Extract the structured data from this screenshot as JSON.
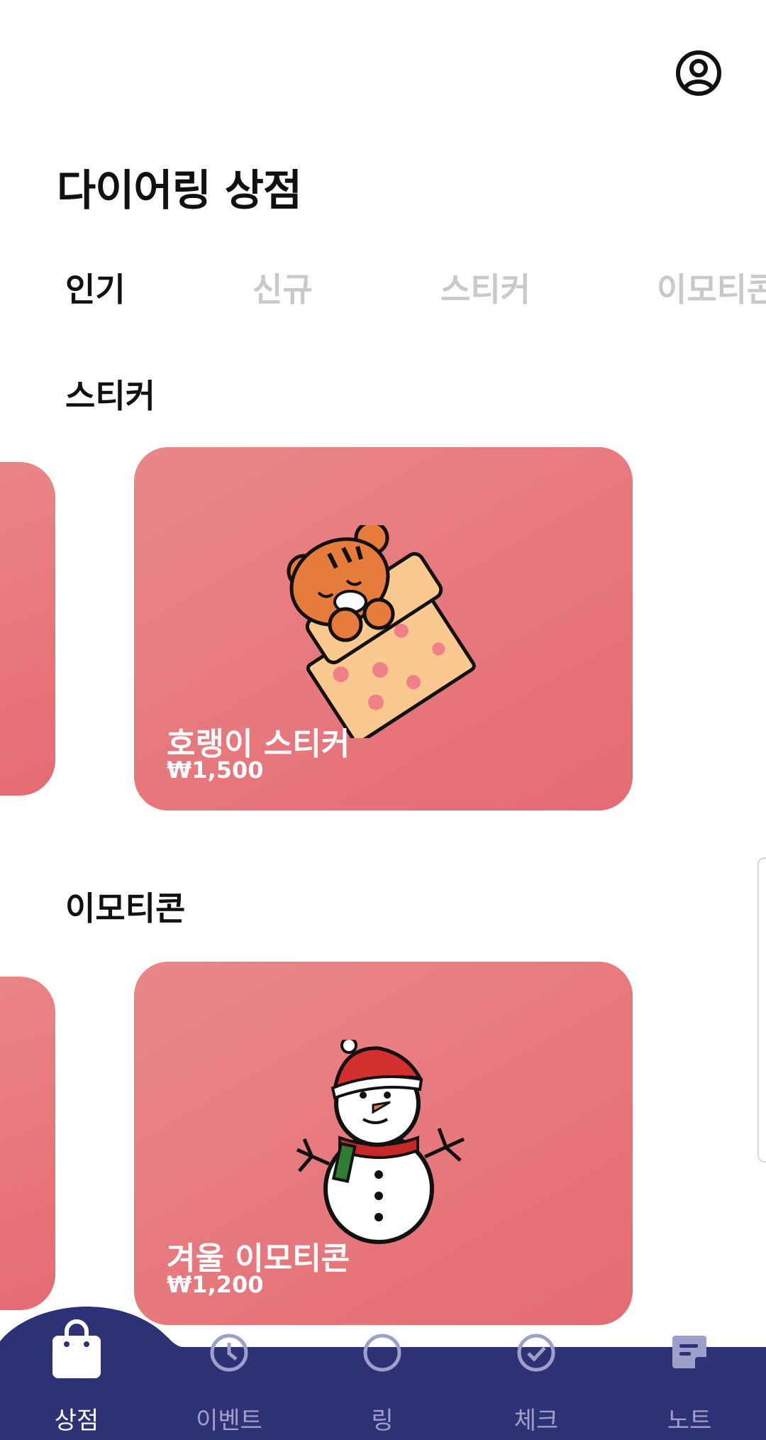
{
  "header": {
    "profile_icon": "user-circle-icon"
  },
  "title": "다이어링 상점",
  "tabs": [
    {
      "label": "인기",
      "active": true
    },
    {
      "label": "신규",
      "active": false
    },
    {
      "label": "스티커",
      "active": false
    },
    {
      "label": "이모티콘",
      "active": false
    }
  ],
  "sections": [
    {
      "title": "스티커",
      "card": {
        "name": "호랭이 스티커",
        "price": "₩1,500",
        "art": "sleeping-tiger-illustration"
      }
    },
    {
      "title": "이모티콘",
      "card": {
        "name": "겨울 이모티콘",
        "price": "₩1,200",
        "art": "snowman-illustration"
      }
    }
  ],
  "bottom_nav": [
    {
      "label": "상점",
      "icon": "shopping-bag-icon",
      "active": true
    },
    {
      "label": "이벤트",
      "icon": "clock-icon",
      "active": false
    },
    {
      "label": "링",
      "icon": "ring-icon",
      "active": false
    },
    {
      "label": "체크",
      "icon": "check-circle-icon",
      "active": false
    },
    {
      "label": "노트",
      "icon": "note-icon",
      "active": false
    }
  ],
  "colors": {
    "card": "#e5717a",
    "nav": "#2e3175",
    "nav_inactive": "#9da0c8",
    "tab_inactive": "#c9c9c9"
  }
}
